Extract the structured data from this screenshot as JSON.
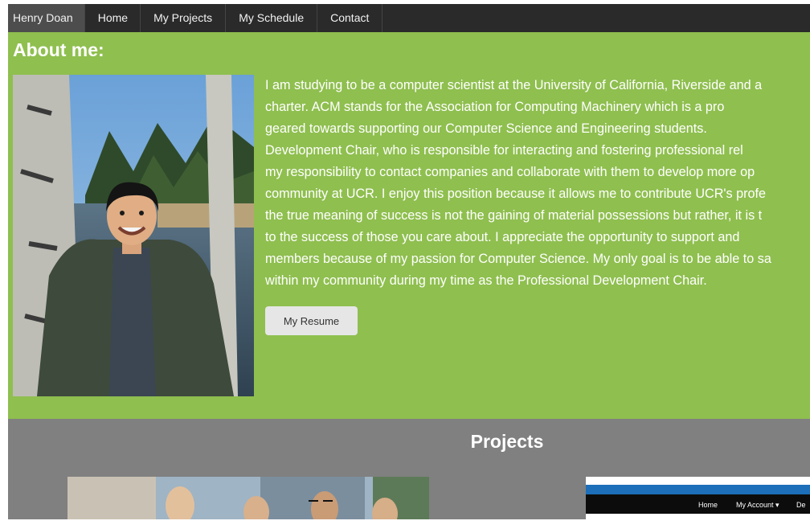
{
  "nav": {
    "brand": "Henry Doan",
    "items": [
      "Home",
      "My Projects",
      "My Schedule",
      "Contact"
    ]
  },
  "about": {
    "heading": "About me:",
    "bio_lines": [
      "I am studying to be a computer scientist at the University of California, Riverside and a",
      "charter. ACM stands for the Association for Computing Machinery which is a pro",
      "geared towards supporting our Computer Science and Engineering students.",
      "Development Chair, who is responsible for interacting and fostering professional rel",
      "my responsibility to contact companies and collaborate with them to develop more op",
      "community at UCR. I enjoy this position because it allows me to contribute UCR's profe",
      "the true meaning of success is not the gaining of material possessions but rather, it is t",
      "to the success of those you care about. I appreciate the opportunity to support and",
      "members because of my passion for Computer Science. My only goal is to be able to sa",
      "within my community during my time as the Professional Development Chair."
    ],
    "resume_button": "My Resume"
  },
  "projects": {
    "heading": "Projects",
    "screenshot_nav": [
      "Home",
      "My Account ▾",
      "De"
    ]
  },
  "colors": {
    "nav_bg": "#2a2a2a",
    "about_bg": "#8fbf4f",
    "projects_bg": "#808080"
  }
}
